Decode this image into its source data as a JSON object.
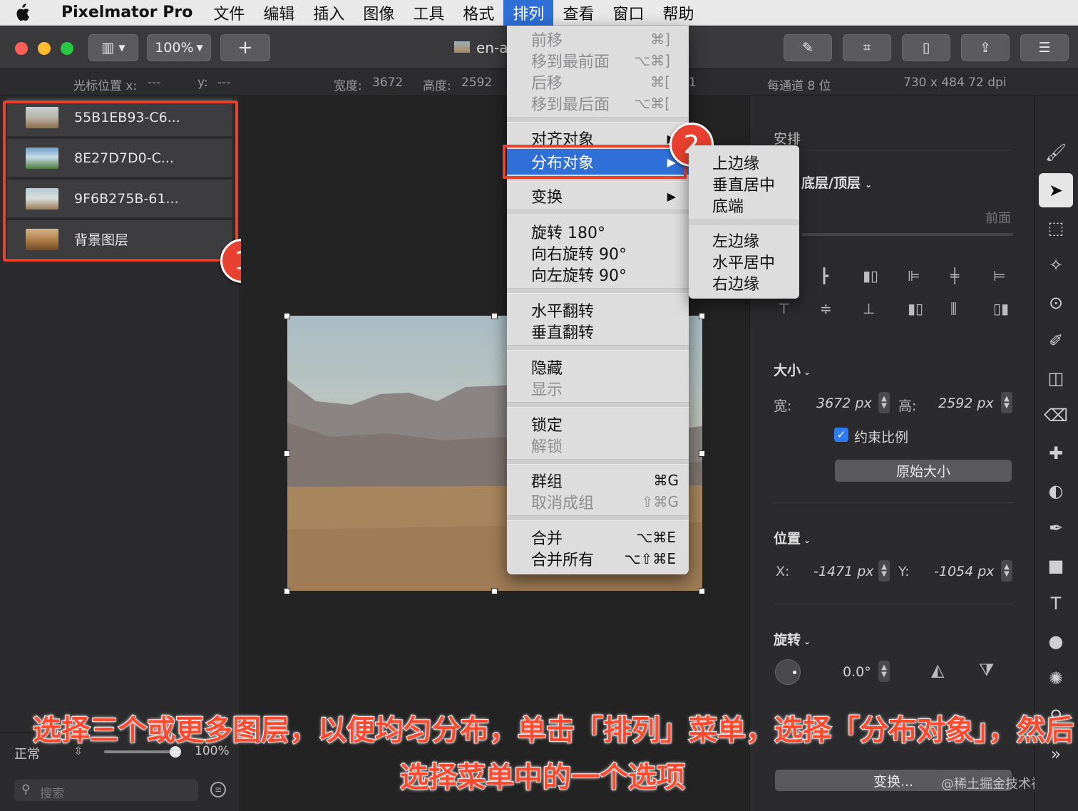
{
  "menubar": {
    "app_name": "Pixelmator Pro",
    "items": [
      "文件",
      "编辑",
      "插入",
      "图像",
      "工具",
      "格式",
      "排列",
      "查看",
      "窗口",
      "帮助"
    ],
    "active": "排列"
  },
  "toolbar": {
    "zoom": "100%",
    "add": "+",
    "doc_title": "en-a"
  },
  "infobar": {
    "cursor_x_label": "光标位置 x:",
    "cursor_x": "---",
    "cursor_y_label": "y:",
    "cursor_y": "---",
    "width_label": "宽度:",
    "width": "3672",
    "height_label": "高度:",
    "height": "2592",
    "partial": "1",
    "bits": "每通道 8 位",
    "dpi": "730 x 484 72 dpi"
  },
  "layers": [
    {
      "name": "55B1EB93-C6..."
    },
    {
      "name": "8E27D7D0-C..."
    },
    {
      "name": "9F6B275B-61..."
    },
    {
      "name": "背景图层"
    }
  ],
  "layers_footer": {
    "blend": "正常",
    "opacity": "100%",
    "opacity_fraction": 1.0,
    "search_placeholder": "搜索"
  },
  "callouts": {
    "one": "1",
    "two": "2"
  },
  "arrange_menu": {
    "group1": [
      {
        "label": "前移",
        "shortcut": "⌘]",
        "disabled": true
      },
      {
        "label": "移到最前面",
        "shortcut": "⌥⌘]",
        "disabled": true
      },
      {
        "label": "后移",
        "shortcut": "⌘[",
        "disabled": true
      },
      {
        "label": "移到最后面",
        "shortcut": "⌥⌘[",
        "disabled": true
      }
    ],
    "align": "对齐对象",
    "distribute": "分布对象",
    "transform": "变换",
    "rotate": [
      "旋转 180°",
      "向右旋转 90°",
      "向左旋转 90°"
    ],
    "flip": [
      "水平翻转",
      "垂直翻转"
    ],
    "hide": "隐藏",
    "show": "显示",
    "lock": "锁定",
    "unlock": "解锁",
    "group": {
      "label": "群组",
      "shortcut": "⌘G"
    },
    "ungroup": {
      "label": "取消成组",
      "shortcut": "⇧⌘G"
    },
    "merge": {
      "label": "合并",
      "shortcut": "⌥⌘E"
    },
    "merge_all": {
      "label": "合并所有",
      "shortcut": "⌥⇧⌘E"
    }
  },
  "distribute_submenu": [
    "上边缘",
    "垂直居中",
    "底端",
    "左边缘",
    "水平居中",
    "右边缘"
  ],
  "inspector": {
    "arrange_title": "安排",
    "arrange_dropdown": "底层/顶层",
    "front_label": "前面",
    "size_title": "大小",
    "width_label": "宽:",
    "width_value": "3672 px",
    "height_label": "高:",
    "height_value": "2592 px",
    "constrain": "约束比例",
    "original_size": "原始大小",
    "position_title": "位置",
    "x_label": "X:",
    "x_value": "-1471 px",
    "y_label": "Y:",
    "y_value": "-1054 px",
    "rotation_title": "旋转",
    "rotation_value": "0.0°",
    "transform_button": "变换..."
  },
  "caption": {
    "line1": "选择三个或更多图层，以便均匀分布，单击「排列」菜单，选择「分布对象」，然后",
    "line2": "选择菜单中的一个选项"
  },
  "watermark": "@稀土掘金技术社区",
  "colors": {
    "menu_active": "#2f6fd8",
    "callout": "#e8412f",
    "caption": "#ff4a30",
    "checkbox": "#2f7bf6"
  }
}
